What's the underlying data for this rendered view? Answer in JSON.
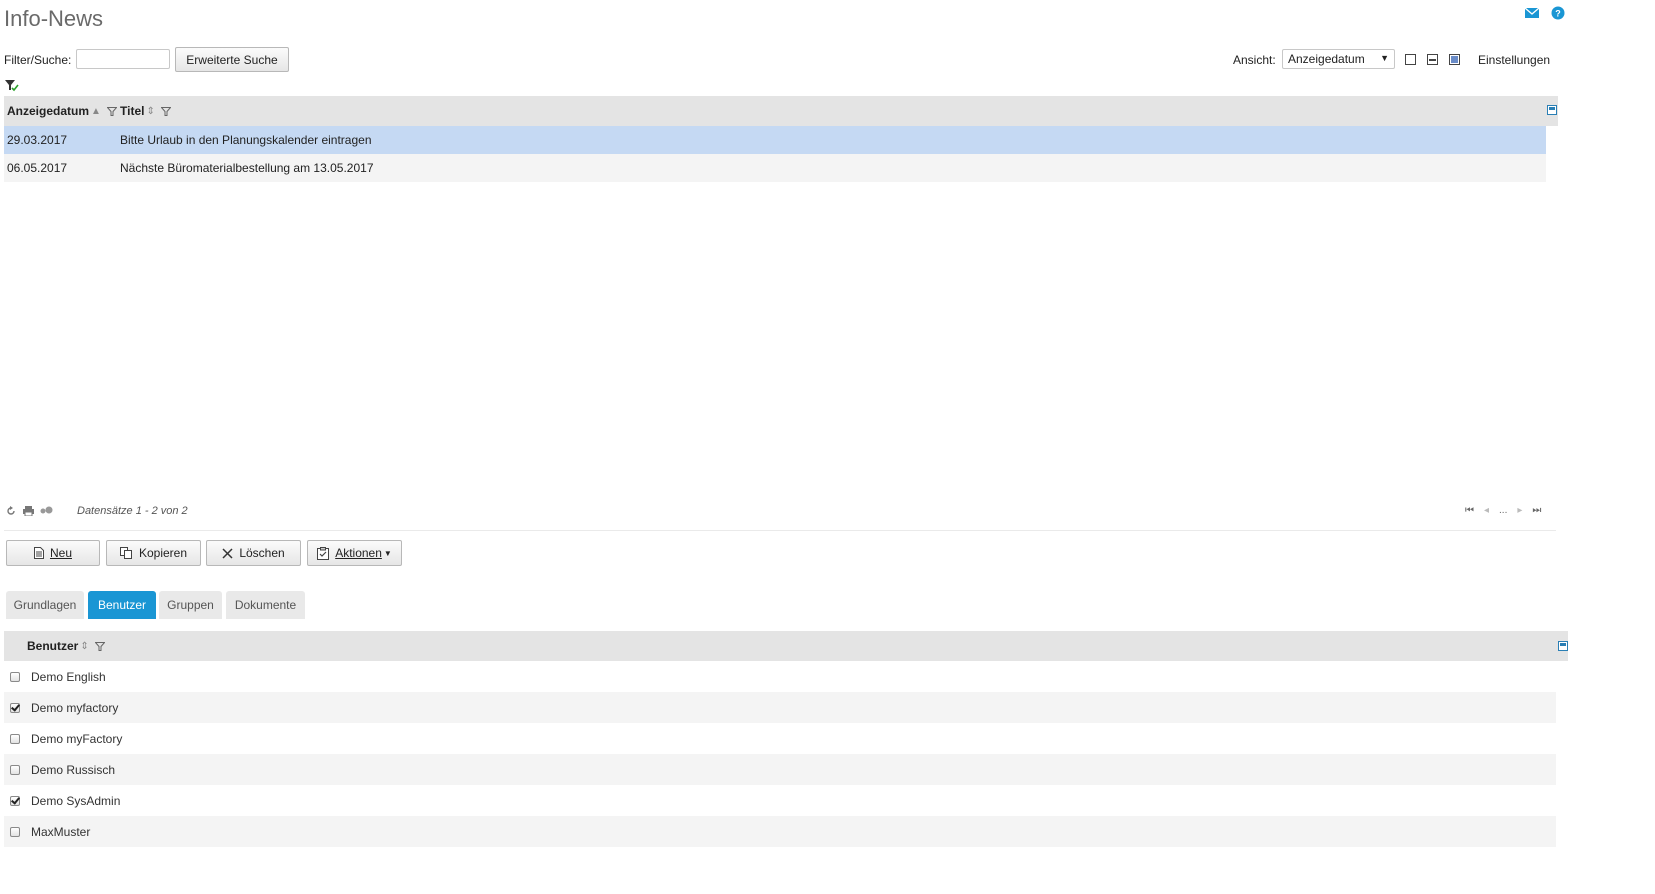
{
  "page": {
    "title": "Info-News"
  },
  "toolbar": {
    "filter_label": "Filter/Suche:",
    "filter_value": "",
    "extended_search_label": "Erweiterte Suche",
    "view_label": "Ansicht:",
    "view_selected": "Anzeigedatum",
    "settings_label": "Einstellungen"
  },
  "grid": {
    "columns": [
      {
        "label": "Anzeigedatum",
        "sort": "▲"
      },
      {
        "label": "Titel",
        "sort": "⇕"
      }
    ],
    "rows": [
      {
        "date": "29.03.2017",
        "title": "Bitte Urlaub in den Planungskalender eintragen",
        "selected": true
      },
      {
        "date": "06.05.2017",
        "title": "Nächste Büromaterialbestellung am 13.05.2017",
        "selected": false
      }
    ],
    "record_info": "Datensätze 1 - 2 von 2",
    "pager_ellipsis": "..."
  },
  "actions": {
    "new_label": "Neu",
    "copy_label": "Kopieren",
    "delete_label": "Löschen",
    "actions_label": "Aktionen"
  },
  "tabs": [
    {
      "label": "Grundlagen",
      "active": false
    },
    {
      "label": "Benutzer",
      "active": true
    },
    {
      "label": "Gruppen",
      "active": false
    },
    {
      "label": "Dokumente",
      "active": false
    }
  ],
  "users": {
    "column": "Benutzer",
    "sort": "⇕",
    "items": [
      {
        "name": "Demo English",
        "checked": false
      },
      {
        "name": "Demo myfactory",
        "checked": true
      },
      {
        "name": "Demo myFactory",
        "checked": false
      },
      {
        "name": "Demo Russisch",
        "checked": false
      },
      {
        "name": "Demo SysAdmin",
        "checked": true
      },
      {
        "name": "MaxMuster",
        "checked": false
      }
    ]
  },
  "colors": {
    "accent": "#1a96d4",
    "selected_row": "#c5d9f3",
    "header_bg": "#e4e4e4"
  }
}
